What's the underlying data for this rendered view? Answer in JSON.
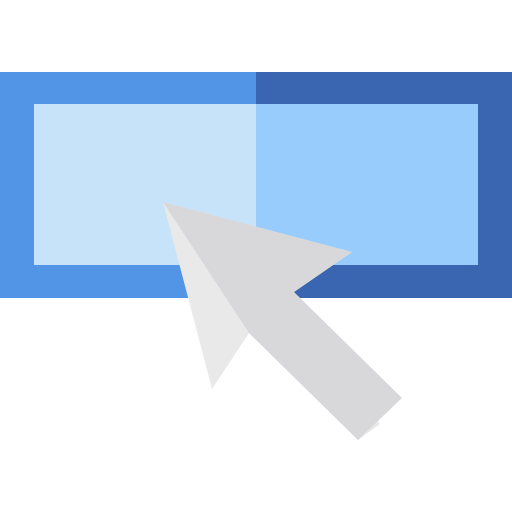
{
  "icon": {
    "name": "click-button-icon",
    "colors": {
      "background": "#ffffff",
      "frame_left": "#5294e6",
      "frame_right": "#3a65b0",
      "inner_left": "#c7e3fa",
      "inner_right": "#97ccfc",
      "cursor_light": "#e9e9ea",
      "cursor_shade": "#d8d8da"
    }
  },
  "cursor": {
    "icon": "mouse-pointer-arrow"
  }
}
